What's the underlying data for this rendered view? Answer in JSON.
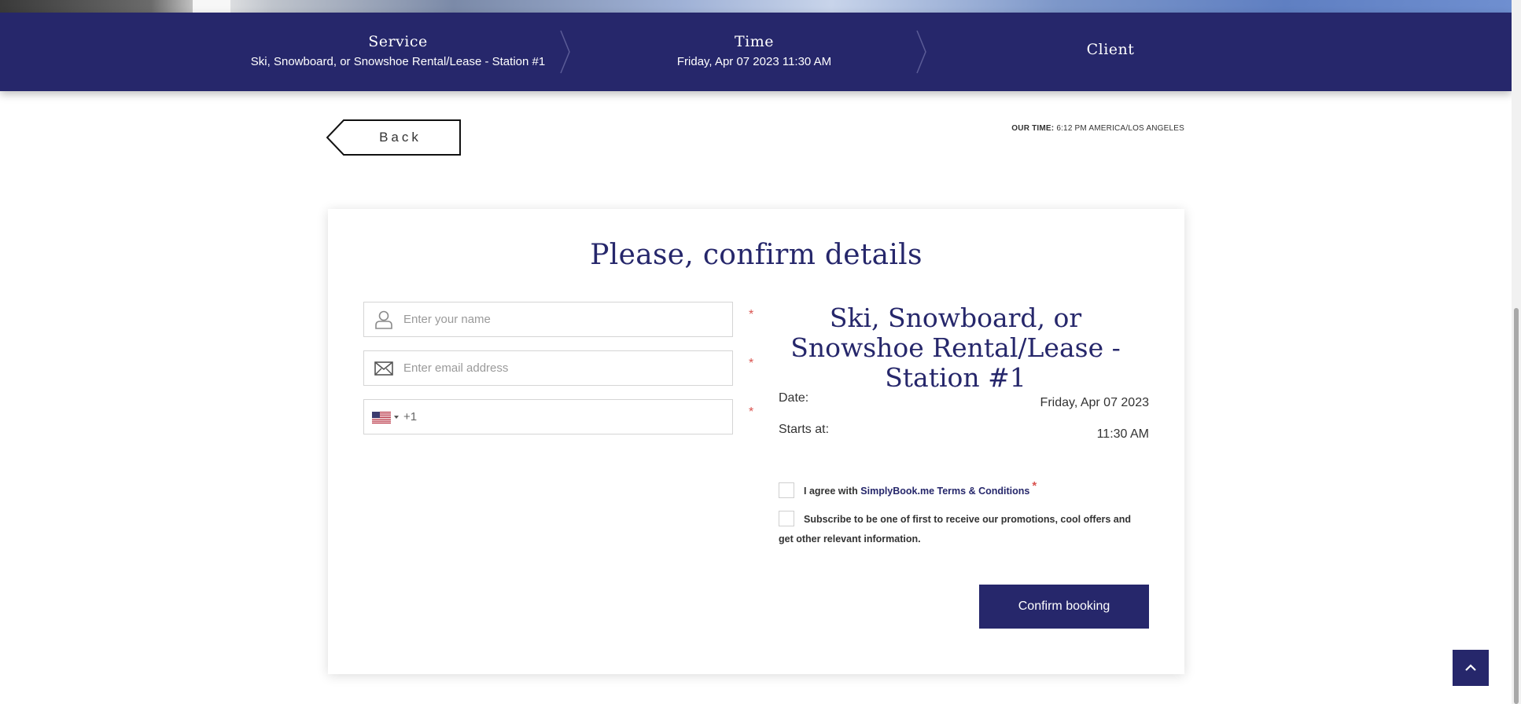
{
  "steps": {
    "service": {
      "title": "Service",
      "value": "Ski, Snowboard, or Snowshoe Rental/Lease - Station #1"
    },
    "time": {
      "title": "Time",
      "value": "Friday, Apr 07 2023 11:30 AM"
    },
    "client": {
      "title": "Client"
    }
  },
  "nav": {
    "back_label": "Back",
    "our_time_label": "OUR TIME:",
    "our_time_value": "6:12 PM AMERICA/LOS ANGELES"
  },
  "form": {
    "title": "Please, confirm details",
    "name_placeholder": "Enter your name",
    "email_placeholder": "Enter email address",
    "phone_code": "+1",
    "required_mark": "*"
  },
  "summary": {
    "service_name": "Ski, Snowboard, or Snowshoe Rental/Lease - Station #1",
    "date_label": "Date:",
    "date_value": "Friday, Apr 07 2023",
    "starts_label": "Starts at:",
    "starts_value": "11:30 AM"
  },
  "consent": {
    "terms_prefix": "I agree with",
    "terms_link": "SimplyBook.me Terms & Conditions",
    "terms_required": "*",
    "subscribe_text": "Subscribe to be one of first to receive our promotions, cool offers and get other relevant information."
  },
  "actions": {
    "confirm_label": "Confirm booking"
  },
  "icons": {
    "name_field": "user-icon",
    "email_field": "envelope-icon",
    "phone_country": "us-flag-icon",
    "back_to_top": "chevron-up-icon"
  },
  "colors": {
    "primary": "#26276b",
    "required": "#d9534f"
  }
}
